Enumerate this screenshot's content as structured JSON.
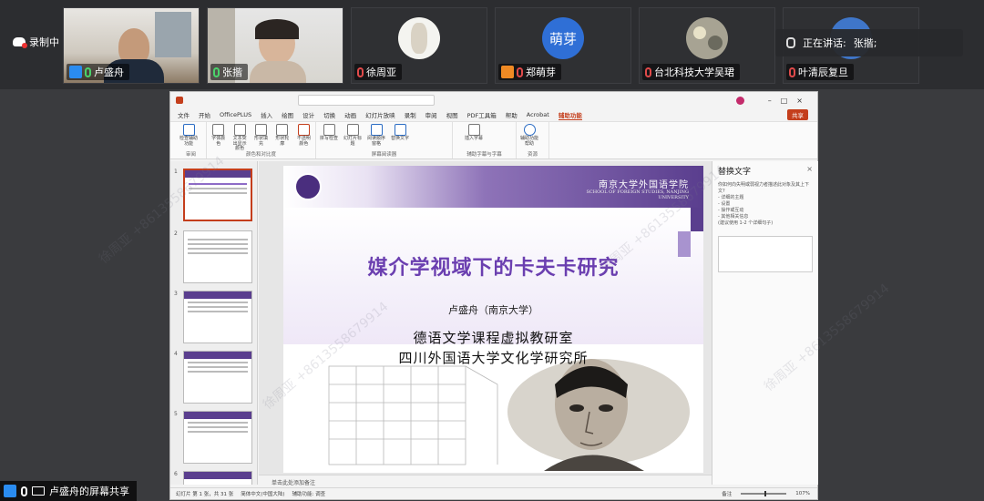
{
  "meeting": {
    "recording_label": "录制中",
    "speaking_label": "正在讲话:",
    "speaking_name": "张揩;",
    "participants": [
      {
        "name": "卢盛舟",
        "host": true,
        "muted": false
      },
      {
        "name": "张揩",
        "host": false,
        "muted": false
      },
      {
        "name": "徐周亚",
        "host": false,
        "muted": true
      },
      {
        "name": "郑萌芽",
        "host": false,
        "muted": true,
        "avatar_text": "萌芽",
        "badge": true
      },
      {
        "name": "台北科技大学吴珺",
        "host": false,
        "muted": true
      },
      {
        "name": "叶清辰复旦",
        "host": false,
        "muted": true
      }
    ],
    "share_label": "卢盛舟的屏幕共享"
  },
  "ppt": {
    "menu": [
      "文件",
      "开始",
      "OfficePLUS",
      "插入",
      "绘图",
      "设计",
      "切换",
      "动画",
      "幻灯片放映",
      "录制",
      "审阅",
      "视图",
      "PDF工具箱",
      "帮助",
      "Acrobat",
      "辅助功能"
    ],
    "active_menu": "辅助功能",
    "share_button": "共享",
    "ribbon_groups": [
      {
        "name": "审阅",
        "buttons": [
          "检查辅助功能"
        ]
      },
      {
        "name": "颜色和对比度",
        "buttons": [
          "字体颜色",
          "文本突出显示颜色",
          "形状填充",
          "形状轮廓",
          "不透明颜色"
        ]
      },
      {
        "name": "屏幕阅读器",
        "buttons": [
          "拼写检查",
          "幻灯片标题",
          "阅读顺序窗格",
          "替换文字"
        ]
      },
      {
        "name": "辅助字幕与字幕",
        "buttons": [
          "插入字幕"
        ]
      },
      {
        "name": "资源",
        "buttons": [
          "辅助功能帮助"
        ]
      }
    ],
    "slide_numbers": [
      "1",
      "2",
      "3",
      "4",
      "5",
      "6"
    ],
    "slide": {
      "school_cn": "南京大学外国语学院",
      "school_en": "SCHOOL OF FOREIGN STUDIES, NANJING UNIVERSITY",
      "title": "媒介学视域下的卡夫卡研究",
      "author": "卢盛舟（南京大学）",
      "line1": "德语文学课程虚拟教研室",
      "line2": "四川外国语大学文化学研究所"
    },
    "notes_placeholder": "单击此处添加备注",
    "alt_pane": {
      "title": "替换文字",
      "close": "×",
      "description": "你如何向失明或弱视力者描述此对象及其上下文?\n- 详细的主题\n- 设置\n- 操作或互动\n- 其他相关信息\n(建议使用 1-2 个详细句子)"
    },
    "status": {
      "slide_info": "幻灯片 第 1 张，共 31 张",
      "language": "简体中文(中国大陆)",
      "accessibility": "辅助功能: 调查",
      "notes_btn": "备注",
      "zoom": "107%"
    }
  },
  "watermark": "徐周亚 +8613558679914"
}
